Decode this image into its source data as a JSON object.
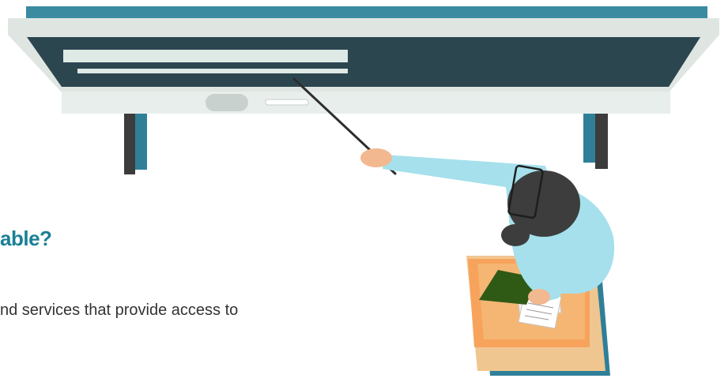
{
  "content": {
    "heading_text": "able?",
    "body_text": "nd services that provide access to"
  },
  "colors": {
    "heading": "#1a7f95",
    "body": "#333333",
    "board_frame": "#dfe6e2",
    "board_surface": "#2c4650",
    "board_top_strip": "#3a8aa0",
    "leg_dark": "#3c3c3c",
    "leg_teal": "#2f7f99",
    "shirt": "#a5e0ec",
    "hair": "#3d3d3d",
    "skin": "#f2b890",
    "desk_top": "#f7a35c",
    "desk_side": "#f0c690",
    "folder": "#2f5a16",
    "pointer": "#2e2e2e"
  },
  "illustration": {
    "subject": "teacher-pointing-at-whiteboard"
  }
}
